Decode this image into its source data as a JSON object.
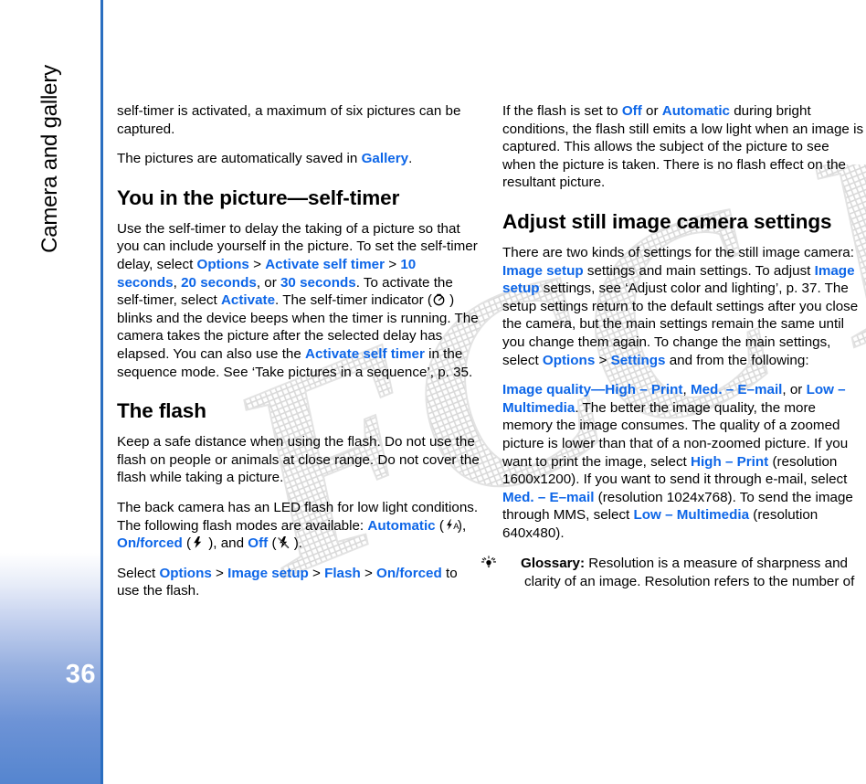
{
  "page": {
    "number": "36",
    "chapter_title": "Camera and gallery",
    "watermark_text": "FCC Draft",
    "accent_link_color": "#0d66e8",
    "sidebar_blue": "#2a6ec0"
  },
  "left_column": {
    "para_1": {
      "t1": "self-timer is activated, a maximum of six pictures can be captured."
    },
    "para_2": {
      "t1": "The pictures are automatically saved in ",
      "l1": "Gallery",
      "t2": "."
    },
    "heading_1": "You in the picture—self-timer",
    "para_3": {
      "t1": "Use the self-timer to delay the taking of a picture so that you can include yourself in the picture. To set the self-timer delay, select ",
      "l1": "Options",
      "t2": " > ",
      "l2": "Activate self timer",
      "t3": " > ",
      "l3": "10 seconds",
      "t4": ", ",
      "l4": "20 seconds",
      "t5": ", or ",
      "l5": "30 seconds",
      "t6": ". To activate the self-timer, select ",
      "l6": "Activate",
      "t7": ". The self-timer indicator (",
      "icon1": "self-timer-indicator-icon",
      "t8": " ) blinks and the device beeps when the timer is running. The camera takes the picture after the selected delay has elapsed. You can also use the ",
      "l7": "Activate self timer",
      "t9": " in the sequence mode. See ‘Take pictures in a sequence’, p. 35."
    },
    "heading_2": "The flash",
    "para_4": {
      "t1": "Keep a safe distance when using the flash. Do not use the flash on people or animals at close range. Do not cover the flash while taking a picture."
    },
    "para_5": {
      "t1": "The back camera has an LED flash for low light conditions. The following flash modes are available: ",
      "l1": "Automatic",
      "t2": " (",
      "icon1": "flash-automatic-icon",
      "t3": "), ",
      "l2": "On/forced",
      "t4": " (",
      "icon2": "flash-on-icon",
      "t5": " ), and ",
      "l3": "Off",
      "t6": " (",
      "icon3": "flash-off-icon",
      "t7": " )."
    },
    "para_6": {
      "t1": "Select ",
      "l1": "Options",
      "t2": " > ",
      "l2": "Image setup",
      "t3": " > ",
      "l3": "Flash",
      "t4": " > ",
      "l4": "On/forced",
      "t5": " to use the flash."
    }
  },
  "right_column": {
    "para_1": {
      "t1": "If the flash is set to ",
      "l1": "Off",
      "t2": " or ",
      "l2": "Automatic",
      "t3": " during bright conditions, the flash still emits a low light when an image is captured. This allows the subject of the picture to see when the picture is taken. There is no flash effect on the resultant picture."
    },
    "heading_1": "Adjust still image camera settings",
    "para_2": {
      "t1": "There are two kinds of settings for the still image camera: ",
      "l1": "Image setup",
      "t2": " settings and main settings. To adjust ",
      "l2": "Image setup",
      "t3": " settings, see ‘Adjust color and lighting’, p. 37. The setup settings return to the default settings after you close the camera, but the main settings remain the same until you change them again. To change the main settings, select ",
      "l3": "Options",
      "t4": " > ",
      "l4": "Settings",
      "t5": " and from the following:"
    },
    "para_3": {
      "l1": "Image quality",
      "t1": "—",
      "l2": "High – Print",
      "t2": ", ",
      "l3": "Med. – E–mail",
      "t3": ", or ",
      "l4": "Low – Multimedia",
      "t4": ". The better the image quality, the more memory the image consumes. The quality of a zoomed picture is lower than that of a non-zoomed picture. If you want to print the image, select ",
      "l5": "High – Print",
      "t5": " (resolution 1600x1200). If you want to send it through e-mail, select ",
      "l6": "Med. – E–mail",
      "t6": " (resolution 1024x768). To send the image through MMS, select ",
      "l7": "Low – Multimedia",
      "t7": " (resolution 640x480)."
    },
    "glossary": {
      "icon": "glossary-lightbulb-icon",
      "label": "Glossary:",
      "text": " Resolution is a measure of sharpness and clarity of an image. Resolution refers to the number of"
    }
  }
}
